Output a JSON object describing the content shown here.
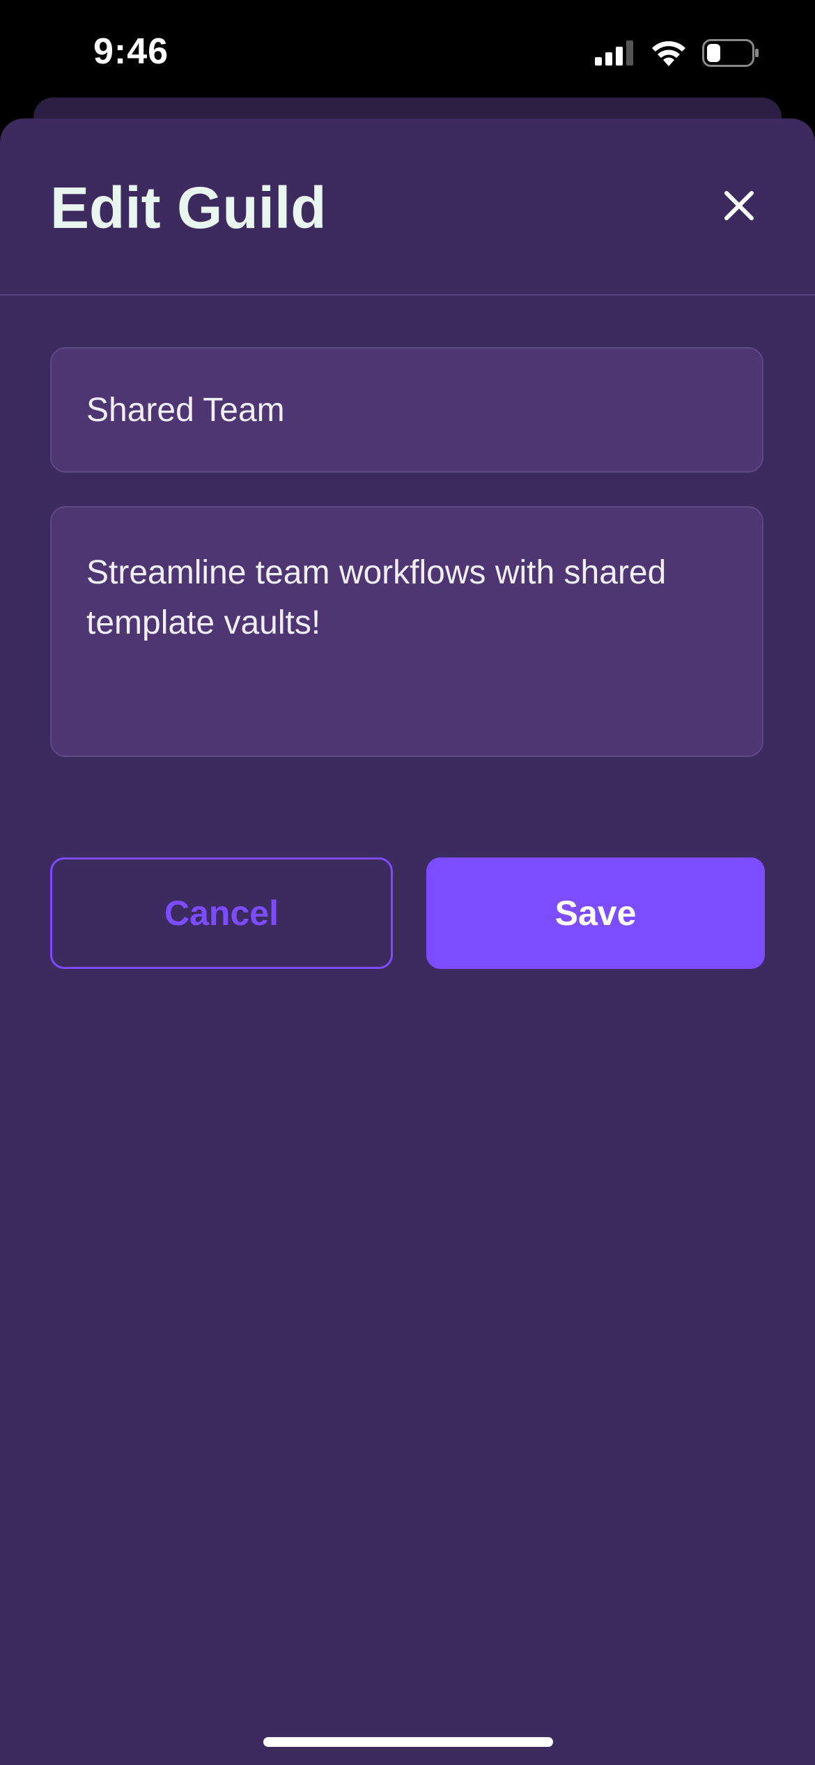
{
  "status_bar": {
    "time": "9:46",
    "icons": [
      "cellular-signal-icon",
      "wifi-icon",
      "battery-icon"
    ],
    "battery_level": 0.3
  },
  "sheet": {
    "title": "Edit Guild",
    "close_icon": "close-icon"
  },
  "form": {
    "name_value": "Shared Team",
    "description_value": "Streamline team workflows with shared template vaults!"
  },
  "actions": {
    "cancel_label": "Cancel",
    "save_label": "Save"
  },
  "colors": {
    "background": "#3d2a5e",
    "field_background": "#4d3671",
    "accent": "#7c4dff",
    "title_text": "#e8f6ef"
  }
}
